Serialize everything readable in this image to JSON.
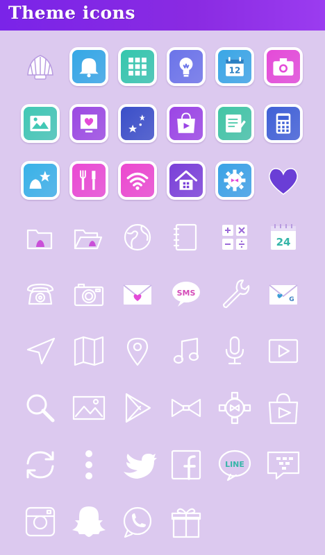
{
  "header": {
    "title": "Theme icons"
  },
  "colors": {
    "header": "#8a2be2",
    "background": "#dcc9ef"
  },
  "icons": [
    {
      "name": "shell-icon",
      "style": "plain"
    },
    {
      "name": "bell-icon",
      "style": "color",
      "bg": "#34a8e6"
    },
    {
      "name": "grid-icon",
      "style": "color",
      "bg": "#34c7ad"
    },
    {
      "name": "lightbulb-icon",
      "style": "color",
      "bg": "#6b74e9"
    },
    {
      "name": "calendar-icon",
      "style": "color",
      "bg": "#3aa7e6",
      "text": "12"
    },
    {
      "name": "camera-icon",
      "style": "color",
      "bg": "#e44ad8"
    },
    {
      "name": "photo-icon",
      "style": "color",
      "bg": "#41c8b4"
    },
    {
      "name": "heart-frame-icon",
      "style": "color",
      "bg": "#9b4ae2"
    },
    {
      "name": "stars-icon",
      "style": "color",
      "bg": "#3a4fc8"
    },
    {
      "name": "play-bag-icon",
      "style": "color",
      "bg": "#9b45e5"
    },
    {
      "name": "notepad-icon",
      "style": "color",
      "bg": "#41c6a5"
    },
    {
      "name": "calculator-icon",
      "style": "color",
      "bg": "#3f61d6"
    },
    {
      "name": "shells-icon",
      "style": "color",
      "bg": "#39b2e8"
    },
    {
      "name": "tools-icon",
      "style": "color",
      "bg": "#ea4ad3"
    },
    {
      "name": "wifi-icon",
      "style": "color",
      "bg": "#ec48cf"
    },
    {
      "name": "home-icon",
      "style": "color",
      "bg": "#7a40d8"
    },
    {
      "name": "gear-icon",
      "style": "color",
      "bg": "#3aa3e6"
    },
    {
      "name": "heart-icon",
      "style": "plain"
    },
    {
      "name": "folder-shell-icon",
      "style": "plain"
    },
    {
      "name": "open-folder-icon",
      "style": "plain"
    },
    {
      "name": "globe-icon",
      "style": "plain"
    },
    {
      "name": "address-book-icon",
      "style": "plain"
    },
    {
      "name": "calculator-signs-icon",
      "style": "plain"
    },
    {
      "name": "calendar-24-icon",
      "style": "plain",
      "text": "24"
    },
    {
      "name": "telephone-icon",
      "style": "plain"
    },
    {
      "name": "camera-outline-icon",
      "style": "plain"
    },
    {
      "name": "envelope-heart-icon",
      "style": "plain"
    },
    {
      "name": "sms-bubble-icon",
      "style": "plain",
      "text": "SMS"
    },
    {
      "name": "wrench-icon",
      "style": "plain"
    },
    {
      "name": "gmail-envelope-icon",
      "style": "plain",
      "text": "G"
    },
    {
      "name": "navigation-arrow-icon",
      "style": "plain"
    },
    {
      "name": "map-icon",
      "style": "plain"
    },
    {
      "name": "location-pin-icon",
      "style": "plain"
    },
    {
      "name": "music-note-icon",
      "style": "plain"
    },
    {
      "name": "microphone-icon",
      "style": "plain"
    },
    {
      "name": "video-play-icon",
      "style": "plain"
    },
    {
      "name": "search-icon",
      "style": "plain"
    },
    {
      "name": "image-icon",
      "style": "plain"
    },
    {
      "name": "play-store-icon",
      "style": "plain"
    },
    {
      "name": "bow-icon",
      "style": "plain"
    },
    {
      "name": "settings-gear-icon",
      "style": "plain"
    },
    {
      "name": "shopping-bag-icon",
      "style": "plain"
    },
    {
      "name": "refresh-icon",
      "style": "plain"
    },
    {
      "name": "more-dots-icon",
      "style": "plain"
    },
    {
      "name": "twitter-bird-icon",
      "style": "plain"
    },
    {
      "name": "facebook-icon",
      "style": "plain"
    },
    {
      "name": "line-bubble-icon",
      "style": "plain",
      "text": "LINE"
    },
    {
      "name": "blackberry-messenger-icon",
      "style": "plain"
    },
    {
      "name": "instagram-icon",
      "style": "plain"
    },
    {
      "name": "snapchat-ghost-icon",
      "style": "plain"
    },
    {
      "name": "whatsapp-icon",
      "style": "plain"
    },
    {
      "name": "gift-box-icon",
      "style": "plain"
    }
  ]
}
